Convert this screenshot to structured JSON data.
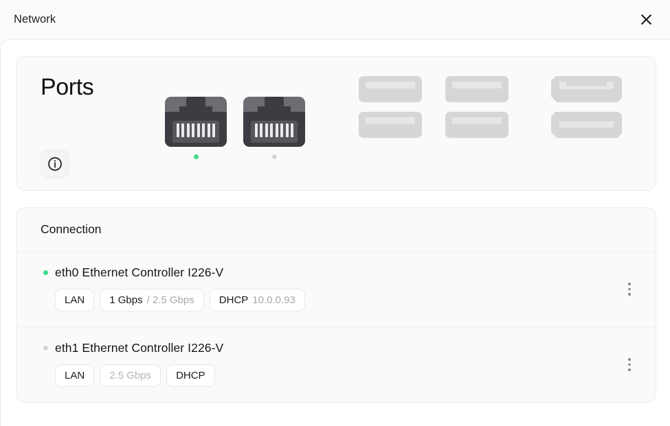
{
  "window": {
    "title": "Network",
    "close_label": "×",
    "close_icon": "close-icon"
  },
  "ports": {
    "title": "Ports",
    "info_icon": "info-circle-icon",
    "ethernet": [
      {
        "name": "eth0-port",
        "status": "connected",
        "dot_color": "#3ddc8a"
      },
      {
        "name": "eth1-port",
        "status": "disconnected",
        "dot_color": "#d3d6da"
      }
    ],
    "usb": [
      {
        "name": "usb-port-1"
      },
      {
        "name": "usb-port-2"
      },
      {
        "name": "usb-port-3"
      },
      {
        "name": "usb-port-4"
      }
    ],
    "hdmi": [
      {
        "name": "hdmi-port-1"
      },
      {
        "name": "hdmi-port-2"
      }
    ]
  },
  "connection": {
    "header": "Connection",
    "rows": [
      {
        "id": "eth0",
        "status": "connected",
        "dot_color": "#3ddc8a",
        "title": "eth0 Ethernet Controller I226-V",
        "badges": [
          {
            "text": "LAN",
            "muted": false
          },
          {
            "text": "1 Gbps",
            "suffix": " / 2.5 Gbps",
            "muted": false
          },
          {
            "text": "DHCP",
            "suffix": " 10.0.0.93",
            "muted": false
          }
        ],
        "menu_icon": "kebab-menu-icon"
      },
      {
        "id": "eth1",
        "status": "disconnected",
        "dot_color": "#d3d6da",
        "title": "eth1 Ethernet Controller I226-V",
        "badges": [
          {
            "text": "LAN",
            "muted": false
          },
          {
            "text": "2.5 Gbps",
            "muted": true
          },
          {
            "text": "DHCP",
            "muted": false
          }
        ],
        "menu_icon": "kebab-menu-icon"
      }
    ]
  }
}
